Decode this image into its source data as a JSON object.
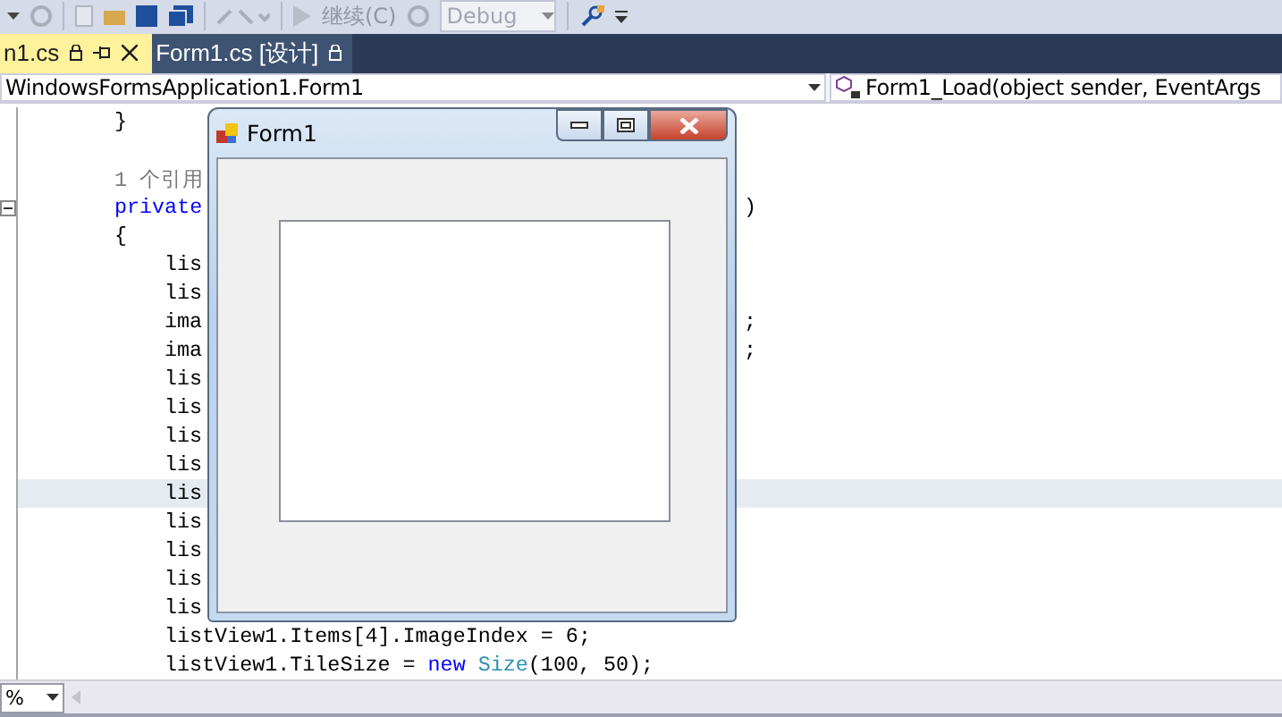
{
  "toolbar": {
    "continue_label": "继续(C)",
    "configuration": "Debug"
  },
  "tabs": [
    {
      "label": "n1.cs",
      "selected": true,
      "locked": true
    },
    {
      "label": "Form1.cs [设计]",
      "selected": false,
      "locked": true
    }
  ],
  "navigation": {
    "type_dropdown": "WindowsFormsApplication1.Form1",
    "member_dropdown": "Form1_Load(object sender, EventArgs"
  },
  "code_lines": [
    {
      "kind": "member",
      "tokens": [
        {
          "text": "}",
          "kind": "plain"
        }
      ]
    },
    {
      "kind": "member"
    },
    {
      "kind": "member",
      "tokens": [
        {
          "text": "1 个引用",
          "kind": "comment"
        }
      ]
    },
    {
      "kind": "member",
      "tokens": [
        {
          "text": "private",
          "kind": "keyword"
        }
      ],
      "tail": ")",
      "foldable": true
    },
    {
      "kind": "member",
      "tokens": [
        {
          "text": "{",
          "kind": "plain"
        }
      ]
    },
    {
      "kind": "body",
      "tokens": [
        {
          "text": "lis",
          "kind": "plain"
        }
      ]
    },
    {
      "kind": "body",
      "tokens": [
        {
          "text": "lis",
          "kind": "plain"
        }
      ]
    },
    {
      "kind": "body",
      "tokens": [
        {
          "text": "ima",
          "kind": "plain"
        }
      ],
      "tail": ";"
    },
    {
      "kind": "body",
      "tokens": [
        {
          "text": "ima",
          "kind": "plain"
        }
      ],
      "tail": ";"
    },
    {
      "kind": "body",
      "tokens": [
        {
          "text": "lis",
          "kind": "plain"
        }
      ]
    },
    {
      "kind": "body",
      "tokens": [
        {
          "text": "lis",
          "kind": "plain"
        }
      ]
    },
    {
      "kind": "body",
      "tokens": [
        {
          "text": "lis",
          "kind": "plain"
        }
      ]
    },
    {
      "kind": "body",
      "tokens": [
        {
          "text": "lis",
          "kind": "plain"
        }
      ]
    },
    {
      "kind": "body",
      "tokens": [
        {
          "text": "lis",
          "kind": "plain"
        }
      ],
      "current": true
    },
    {
      "kind": "body",
      "tokens": [
        {
          "text": "lis",
          "kind": "plain"
        }
      ]
    },
    {
      "kind": "body",
      "tokens": [
        {
          "text": "lis",
          "kind": "plain"
        }
      ]
    },
    {
      "kind": "body",
      "tokens": [
        {
          "text": "lis",
          "kind": "plain"
        }
      ]
    },
    {
      "kind": "body",
      "tokens": [
        {
          "text": "lis",
          "kind": "plain"
        }
      ]
    },
    {
      "kind": "body",
      "tokens": [
        {
          "text": "listView1.Items[4].ImageIndex = 6;",
          "kind": "plain"
        }
      ]
    },
    {
      "kind": "body",
      "tokens": [
        {
          "text": "listView1.TileSize = ",
          "kind": "plain"
        },
        {
          "text": "new ",
          "kind": "keyword"
        },
        {
          "text": "Size",
          "kind": "type"
        },
        {
          "text": "(100, 50);",
          "kind": "plain"
        }
      ]
    }
  ],
  "form_window": {
    "title": "Form1"
  },
  "zoom": {
    "value": "%"
  }
}
